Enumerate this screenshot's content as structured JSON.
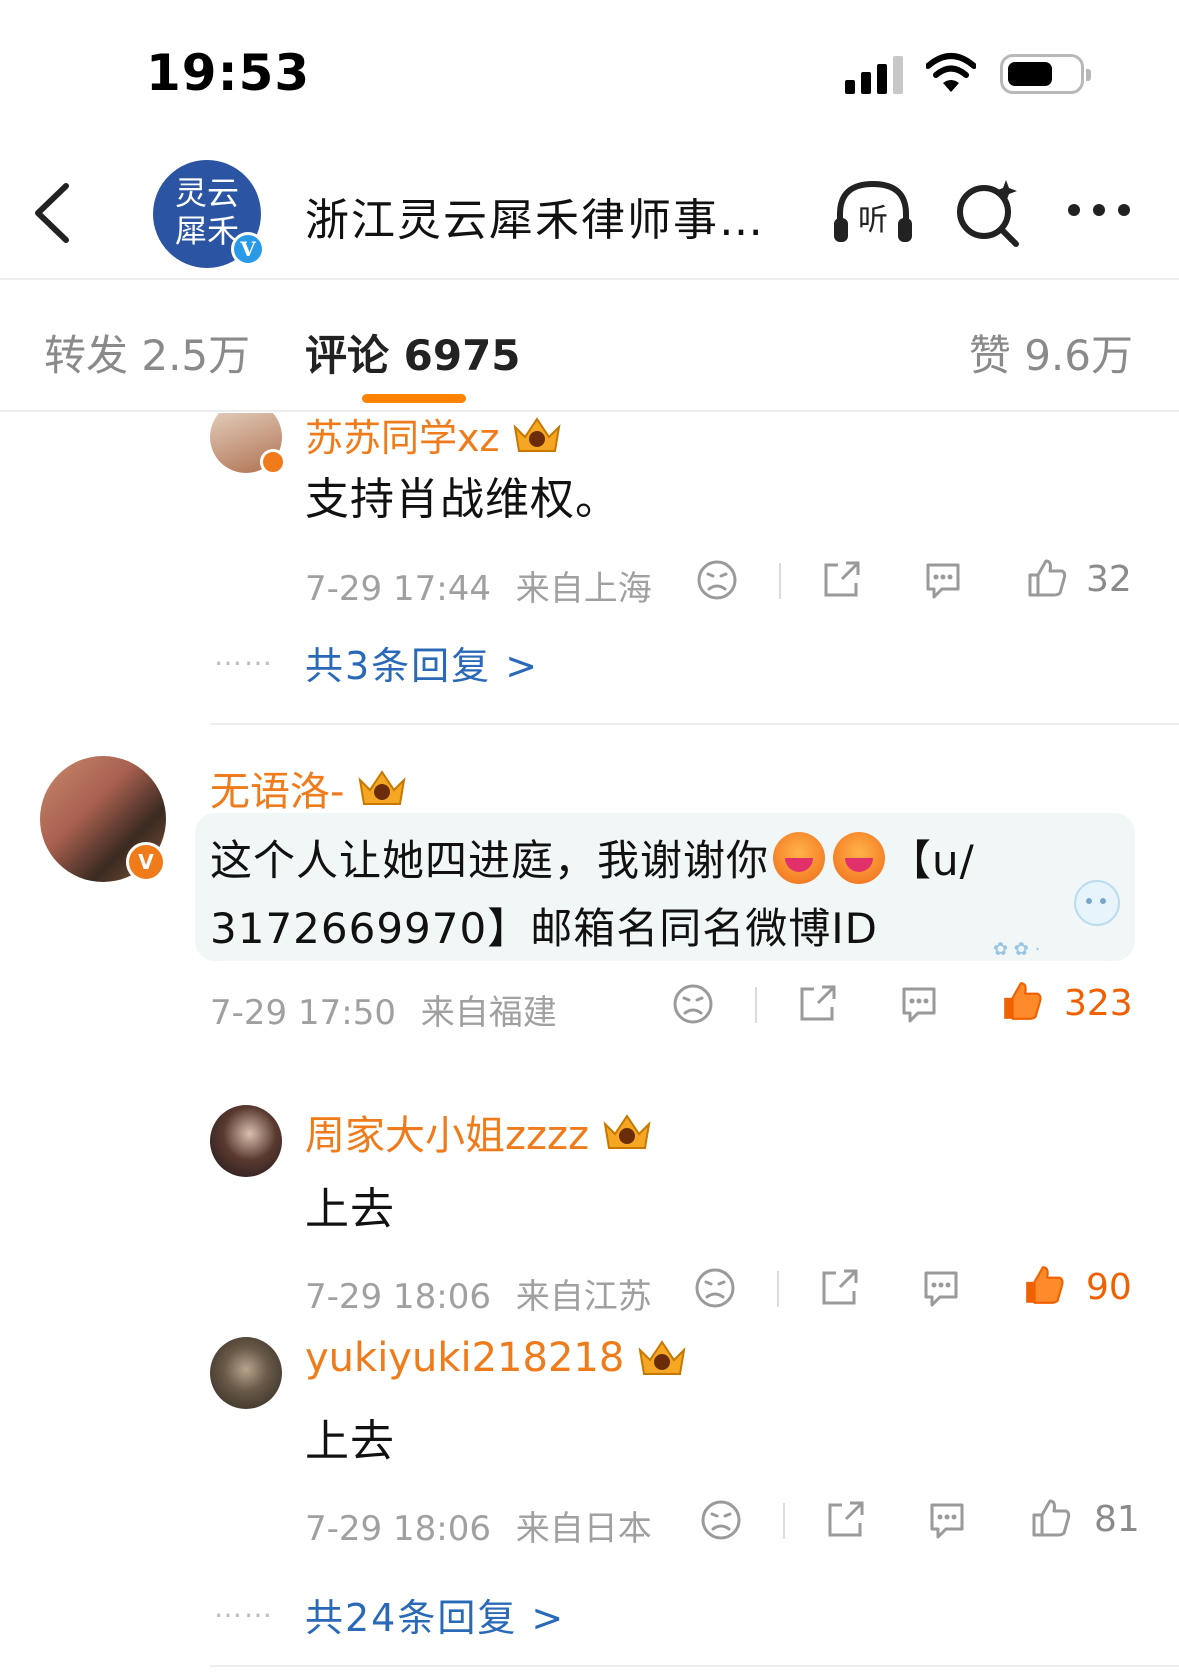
{
  "status_bar": {
    "time": "19:53"
  },
  "header": {
    "title": "浙江灵云犀禾律师事…",
    "avatar_text": "灵云犀禾",
    "verified_mark": "V"
  },
  "tabs": {
    "repost": "转发 2.5万",
    "comments": "评论 6975",
    "likes": "赞 9.6万"
  },
  "comments": [
    {
      "username": "苏苏同学xz",
      "text": "支持肖战维权。",
      "time": "7-29 17:44",
      "location": "来自上海",
      "likes": "32",
      "liked": false,
      "replies_link": "共3条回复 >"
    },
    {
      "username": "无语洛-",
      "text_line1_a": "这个人让她四进庭，我谢谢你",
      "text_line1_b": "【u/",
      "text_line2": "3172669970】邮箱名同名微博ID",
      "time": "7-29 17:50",
      "location": "来自福建",
      "likes": "323",
      "liked": true,
      "verified_mark": "V"
    },
    {
      "username": "周家大小姐zzzz",
      "text": "上去",
      "time": "7-29 18:06",
      "location": "来自江苏",
      "likes": "90",
      "liked": true
    },
    {
      "username": "yukiyuki218218",
      "text": "上去",
      "time": "7-29 18:06",
      "location": "来自日本",
      "likes": "81",
      "liked": false,
      "replies_link": "共24条回复 >"
    }
  ],
  "dots": "……",
  "colors": {
    "accent": "#ff8200",
    "username": "#f07b1a",
    "link": "#2a69b8",
    "meta": "#a0a0a0"
  },
  "icons": [
    "back-icon",
    "listen-icon",
    "search-icon",
    "more-icon",
    "dislike-icon",
    "share-icon",
    "comment-icon",
    "like-icon",
    "crown-icon",
    "verified-icon"
  ]
}
